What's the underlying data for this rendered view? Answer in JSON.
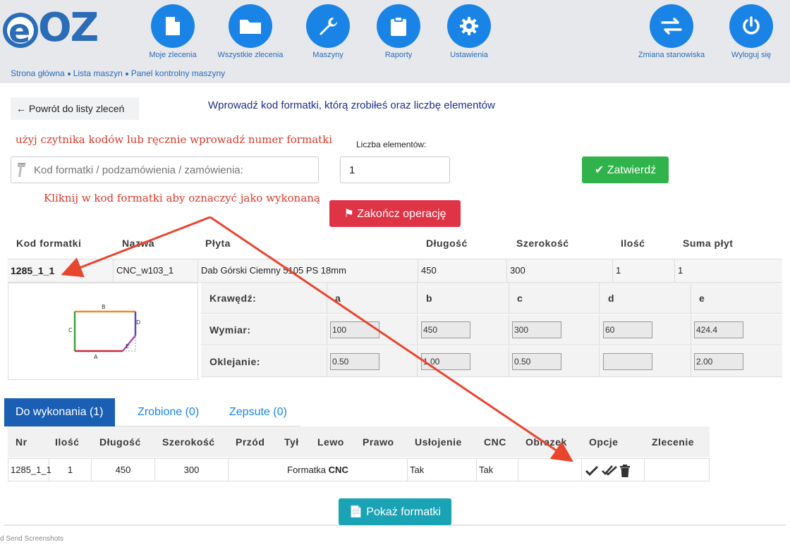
{
  "brand": {
    "logo_e": "e",
    "logo_oz": "OZ",
    "accent": "#1a84e6",
    "logo_color": "#2b6cb8"
  },
  "nav": {
    "items": [
      {
        "label": "Moje zlecenia",
        "icon": "file-icon"
      },
      {
        "label": "Wszystkie zlecenia",
        "icon": "folder-icon"
      },
      {
        "label": "Maszyny",
        "icon": "wrench-icon"
      },
      {
        "label": "Raporty",
        "icon": "clipboard-icon"
      },
      {
        "label": "Ustawienia",
        "icon": "gear-icon"
      }
    ],
    "right": [
      {
        "label": "Zmiana stanowiska",
        "icon": "swap-arrows-icon"
      },
      {
        "label": "Wyloguj się",
        "icon": "power-icon"
      }
    ]
  },
  "breadcrumb": [
    "Strona główna",
    "Lista maszyn",
    "Panel kontrolny maszyny"
  ],
  "back_label": "Powrót do listy zleceń",
  "instructions_title": "Wprowadź kod formatki, którą zrobiłeś oraz liczbę elementów",
  "hint_scanner": "użyj czytnika kodów lub ręcznie wprowadź numer formatki",
  "hint_click": "Kliknij w kod formatki aby oznaczyć jako wykonaną",
  "qty_label": "Liczba elementów:",
  "code_placeholder": "Kod formatki / podzamówienia / zamówienia:",
  "qty_value": "1",
  "confirm_label": "Zatwierdź",
  "finish_label": "Zakończ operację",
  "detail_table": {
    "headers": [
      "Kod formatki",
      "Nazwa",
      "Płyta",
      "Długość",
      "Szerokość",
      "Ilość",
      "Suma płyt"
    ],
    "row": [
      "1285_1_1",
      "CNC_w103_1",
      "Dab Górski Ciemny 5105 PS 18mm",
      "450",
      "300",
      "1",
      "1"
    ]
  },
  "edges": {
    "header_label": "Krawędź:",
    "letters": [
      "a",
      "b",
      "c",
      "d",
      "e"
    ],
    "dimension_label": "Wymiar:",
    "dimensions": [
      "100",
      "450",
      "300",
      "60",
      "424.4"
    ],
    "banding_label": "Oklejanie:",
    "banding": [
      "0.50",
      "1.00",
      "0.50",
      "",
      "2.00"
    ]
  },
  "diagram": {
    "labels": {
      "a": "A",
      "b": "B",
      "c": "C",
      "d": "D",
      "e": "E"
    }
  },
  "tabs": [
    {
      "label": "Do wykonania (1)",
      "active": true
    },
    {
      "label": "Zrobione (0)",
      "active": false
    },
    {
      "label": "Zepsute (0)",
      "active": false
    }
  ],
  "orders_table": {
    "headers": [
      "Nr",
      "Ilość",
      "Długość",
      "Szerokość",
      "Przód",
      "Tył",
      "Lewo",
      "Prawo",
      "Usłojenie",
      "CNC",
      "Obrazek",
      "Opcje",
      "Zlecenie"
    ],
    "row": {
      "nr": "1285_1_1",
      "qty": "1",
      "length": "450",
      "width": "300",
      "cnc_text": "Formatka",
      "cnc_bold": "CNC",
      "grain": "Tak",
      "cnc": "Tak"
    }
  },
  "show_label": "Pokaż formatki",
  "footer": "d Send Screenshots",
  "colors": {
    "green": "#2fb34a",
    "red": "#de3446",
    "teal": "#1aa3b5",
    "tab_active": "#1a5fb4",
    "annotation": "#e8452f"
  }
}
